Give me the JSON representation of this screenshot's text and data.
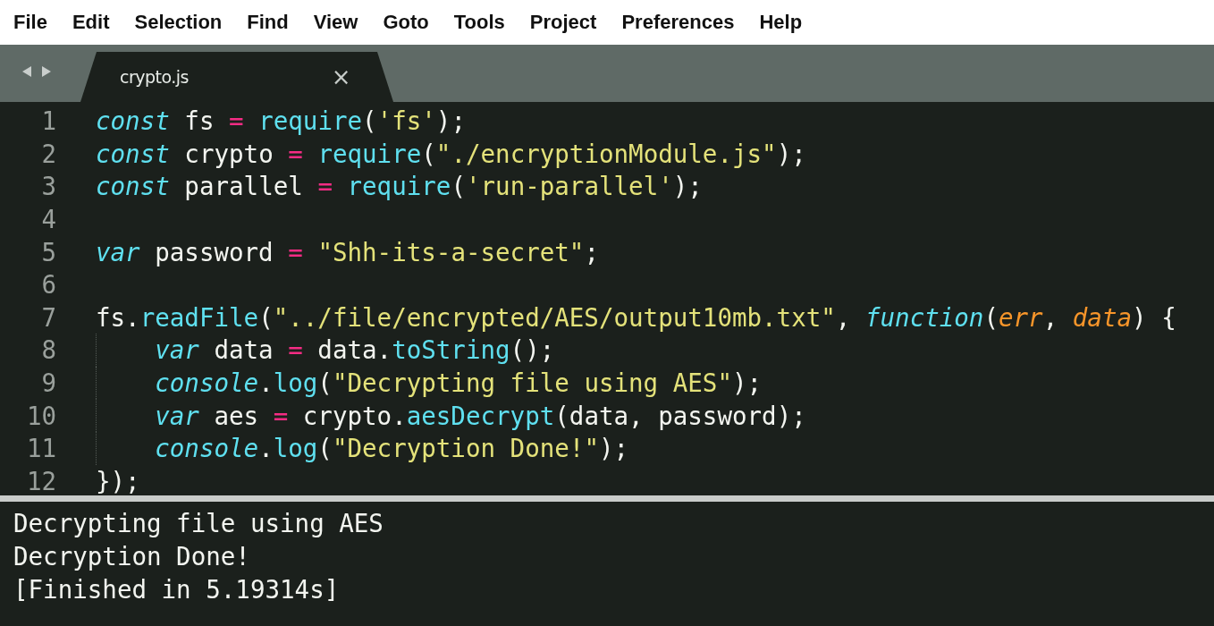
{
  "menu": [
    "File",
    "Edit",
    "Selection",
    "Find",
    "View",
    "Goto",
    "Tools",
    "Project",
    "Preferences",
    "Help"
  ],
  "tabs": [
    {
      "label": "crypto.js",
      "close": "×",
      "selected": true
    }
  ],
  "editor": {
    "lines": [
      {
        "number": "1",
        "indented": false,
        "tokens": [
          {
            "kind": "keyword",
            "text": "const"
          },
          {
            "kind": "plain",
            "text": " fs "
          },
          {
            "kind": "operator",
            "text": "= "
          },
          {
            "kind": "function",
            "text": "require"
          },
          {
            "kind": "plain",
            "text": "("
          },
          {
            "kind": "string",
            "text": "'fs'"
          },
          {
            "kind": "plain",
            "text": ");"
          }
        ]
      },
      {
        "number": "2",
        "indented": false,
        "tokens": [
          {
            "kind": "keyword",
            "text": "const"
          },
          {
            "kind": "plain",
            "text": " crypto "
          },
          {
            "kind": "operator",
            "text": "= "
          },
          {
            "kind": "function",
            "text": "require"
          },
          {
            "kind": "plain",
            "text": "("
          },
          {
            "kind": "string",
            "text": "\"./encryptionModule.js\""
          },
          {
            "kind": "plain",
            "text": ");"
          }
        ]
      },
      {
        "number": "3",
        "indented": false,
        "tokens": [
          {
            "kind": "keyword",
            "text": "const"
          },
          {
            "kind": "plain",
            "text": " parallel "
          },
          {
            "kind": "operator",
            "text": "= "
          },
          {
            "kind": "function",
            "text": "require"
          },
          {
            "kind": "plain",
            "text": "("
          },
          {
            "kind": "string",
            "text": "'run-parallel'"
          },
          {
            "kind": "plain",
            "text": ");"
          }
        ]
      },
      {
        "number": "4",
        "indented": false
      },
      {
        "number": "5",
        "indented": false,
        "tokens": [
          {
            "kind": "keyword",
            "text": "var"
          },
          {
            "kind": "plain",
            "text": " password "
          },
          {
            "kind": "operator",
            "text": "= "
          },
          {
            "kind": "string",
            "text": "\"Shh-its-a-secret\""
          },
          {
            "kind": "plain",
            "text": ";"
          }
        ]
      },
      {
        "number": "6",
        "indented": false
      },
      {
        "number": "7",
        "indented": false,
        "tokens": [
          {
            "kind": "plain",
            "text": "fs."
          },
          {
            "kind": "function",
            "text": "readFile"
          },
          {
            "kind": "plain",
            "text": "("
          },
          {
            "kind": "string",
            "text": "\"../file/encrypted/AES/output10mb.txt\""
          },
          {
            "kind": "plain",
            "text": ", "
          },
          {
            "kind": "keyword",
            "text": "function"
          },
          {
            "kind": "plain",
            "text": "("
          },
          {
            "kind": "param",
            "text": "err"
          },
          {
            "kind": "plain",
            "text": ", "
          },
          {
            "kind": "param",
            "text": "data"
          },
          {
            "kind": "plain",
            "text": ") {"
          }
        ]
      },
      {
        "number": "8",
        "indented": true,
        "tokens": [
          {
            "kind": "keyword",
            "text": "var"
          },
          {
            "kind": "plain",
            "text": " data "
          },
          {
            "kind": "operator",
            "text": "="
          },
          {
            "kind": "plain",
            "text": " data."
          },
          {
            "kind": "function",
            "text": "toString"
          },
          {
            "kind": "plain",
            "text": "();"
          }
        ]
      },
      {
        "number": "9",
        "indented": true,
        "tokens": [
          {
            "kind": "keyword",
            "text": "console"
          },
          {
            "kind": "plain",
            "text": "."
          },
          {
            "kind": "function",
            "text": "log"
          },
          {
            "kind": "plain",
            "text": "("
          },
          {
            "kind": "string",
            "text": "\"Decrypting file using AES\""
          },
          {
            "kind": "plain",
            "text": ");"
          }
        ]
      },
      {
        "number": "10",
        "indented": true,
        "tokens": [
          {
            "kind": "keyword",
            "text": "var"
          },
          {
            "kind": "plain",
            "text": " aes "
          },
          {
            "kind": "operator",
            "text": "="
          },
          {
            "kind": "plain",
            "text": " crypto."
          },
          {
            "kind": "function",
            "text": "aesDecrypt"
          },
          {
            "kind": "plain",
            "text": "(data, password);"
          }
        ]
      },
      {
        "number": "11",
        "indented": true,
        "tokens": [
          {
            "kind": "keyword",
            "text": "console"
          },
          {
            "kind": "plain",
            "text": "."
          },
          {
            "kind": "function",
            "text": "log"
          },
          {
            "kind": "plain",
            "text": "("
          },
          {
            "kind": "string",
            "text": "\"Decryption Done!\""
          },
          {
            "kind": "plain",
            "text": ");"
          }
        ]
      },
      {
        "number": "12",
        "indented": false,
        "tokens": [
          {
            "kind": "plain",
            "text": "});"
          }
        ]
      }
    ]
  },
  "output": [
    "Decrypting file using AES",
    "Decryption Done!",
    "[Finished in 5.19314s]"
  ]
}
